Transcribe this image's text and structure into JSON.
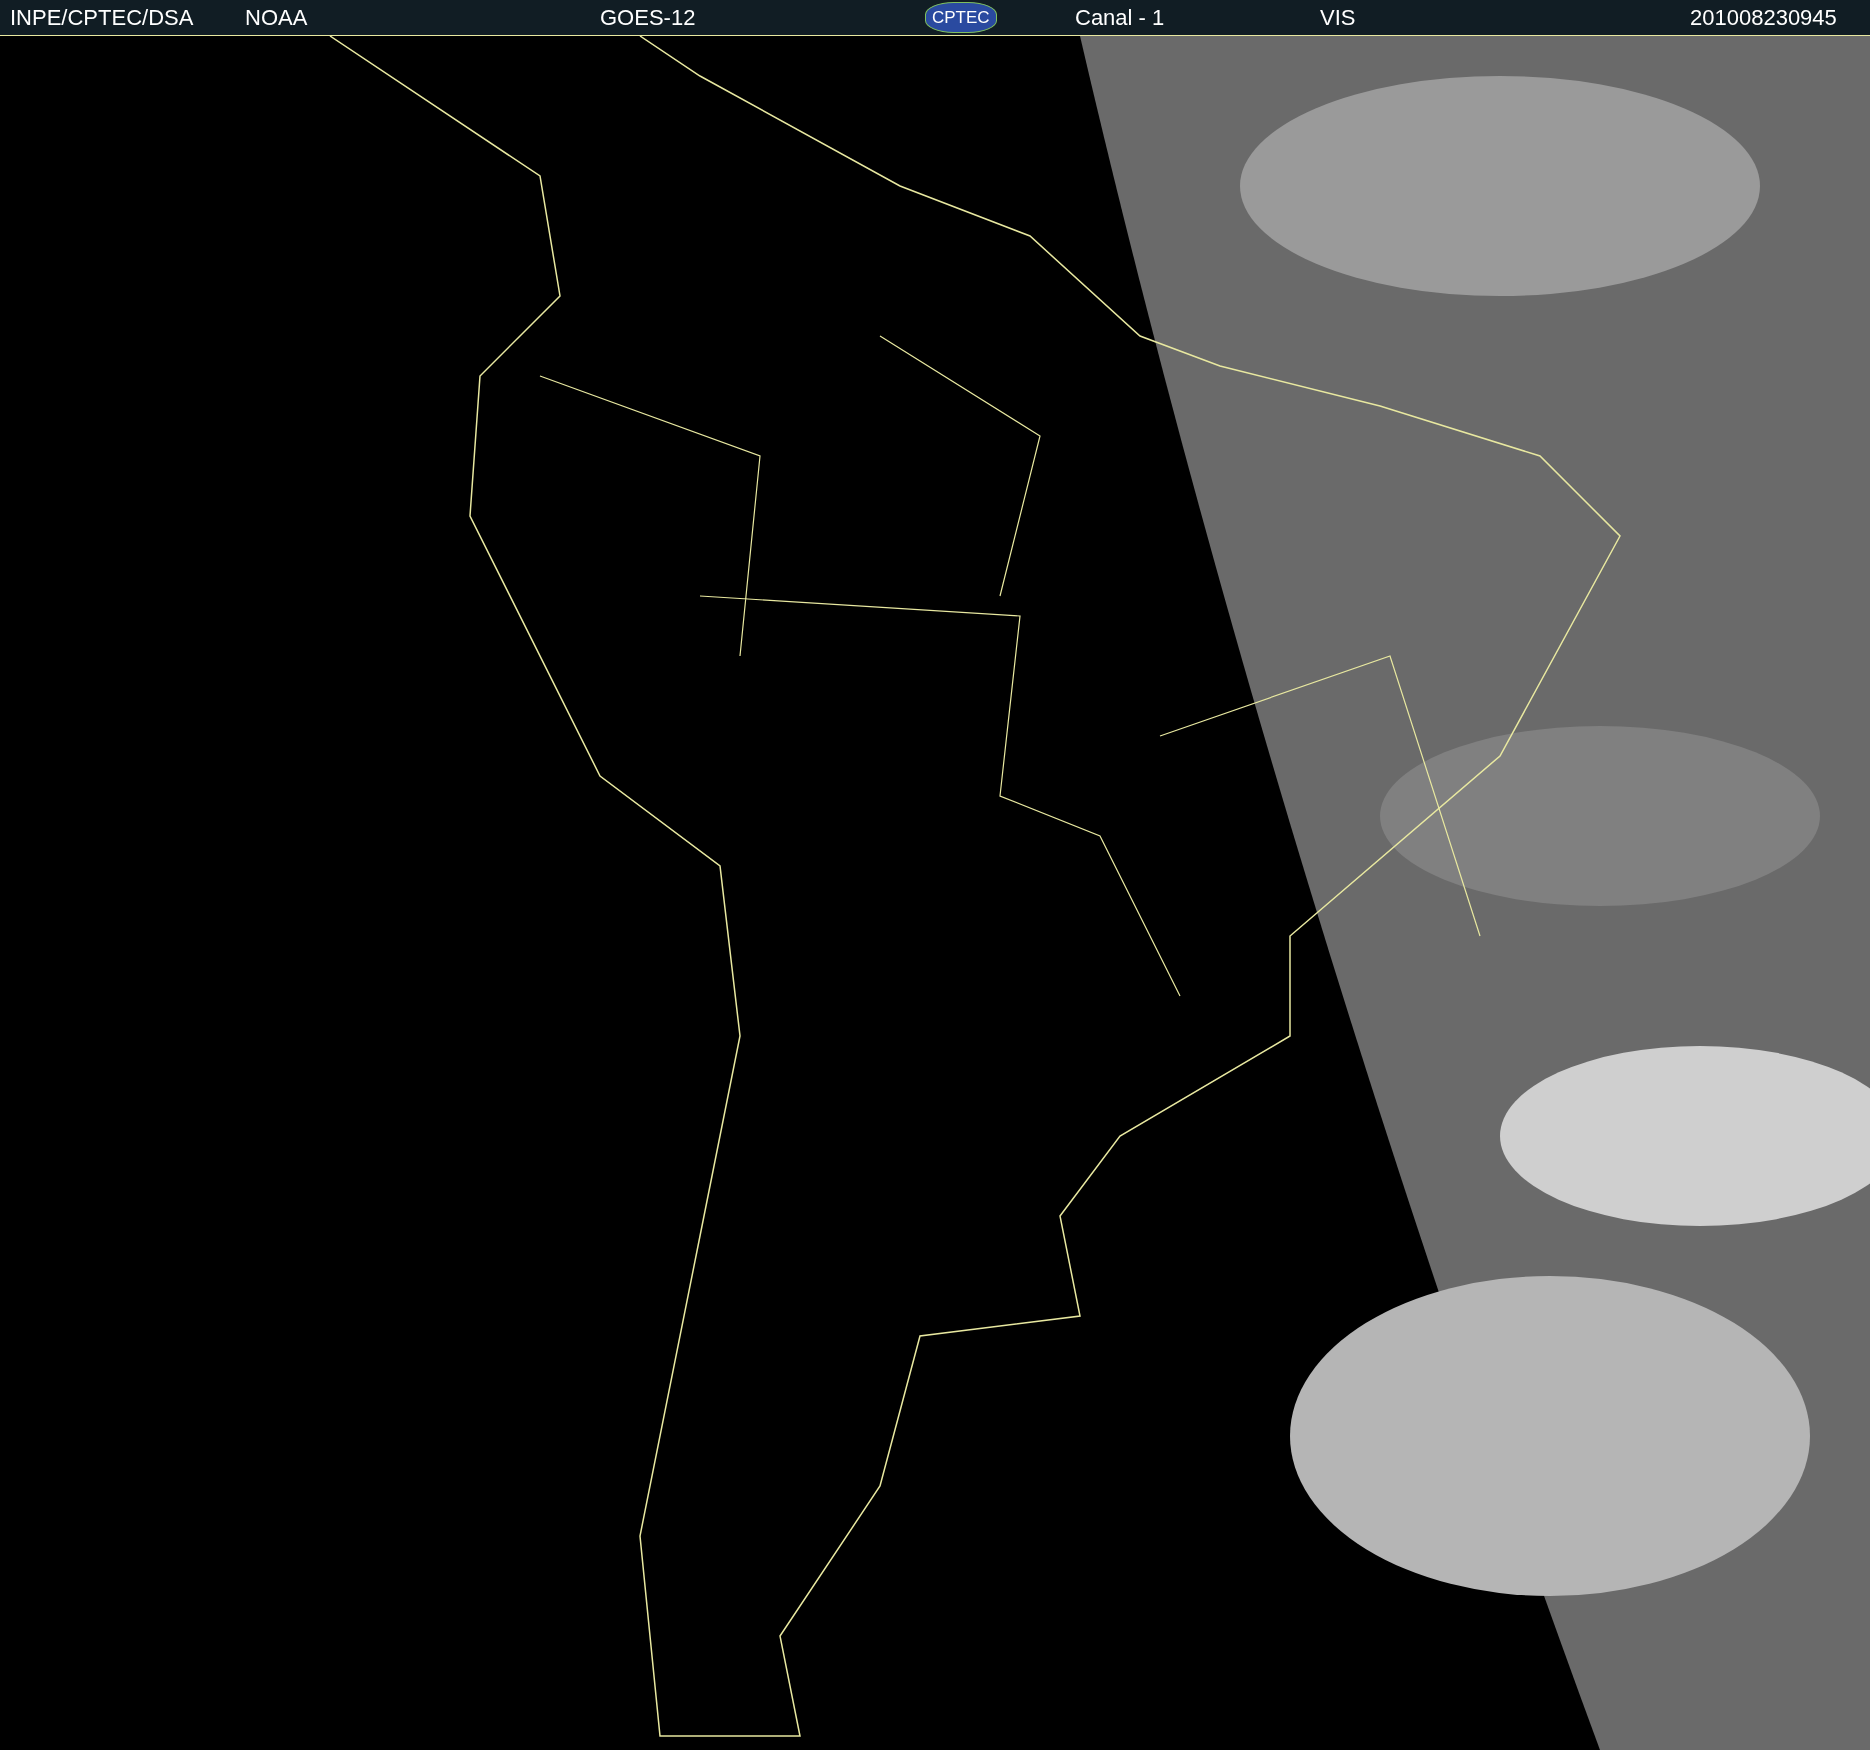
{
  "header": {
    "items": [
      {
        "kind": "text",
        "text": "INPE/CPTEC/DSA"
      },
      {
        "kind": "text",
        "text": "NOAA"
      },
      {
        "kind": "text",
        "text": "GOES-12"
      },
      {
        "kind": "logo",
        "text": "CPTEC"
      },
      {
        "kind": "text",
        "text": "Canal - 1"
      },
      {
        "kind": "text",
        "text": "VIS"
      },
      {
        "kind": "text",
        "text": "201008230945"
      }
    ]
  }
}
